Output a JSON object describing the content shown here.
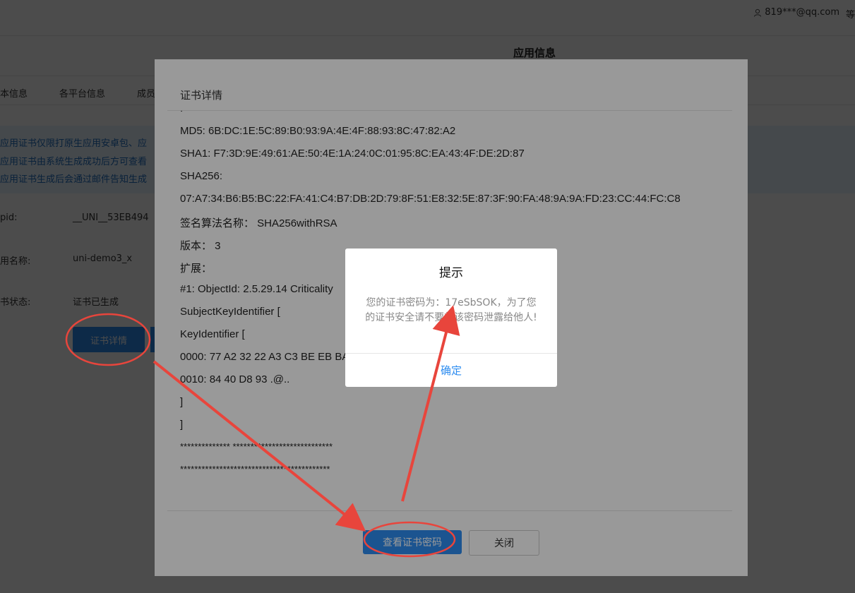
{
  "header": {
    "user_email": "819***@qq.com",
    "edge_char": "等"
  },
  "page": {
    "title": "应用信息"
  },
  "tabs": [
    "本信息",
    "各平台信息",
    "成员"
  ],
  "notice": [
    "应用证书仅限打原生应用安卓包、应",
    "应用证书由系统生成成功后方可查看",
    "应用证书生成后会通过邮件告知生成"
  ],
  "fields": [
    {
      "label": "pid:",
      "value": "__UNI__53EB494"
    },
    {
      "label": "用名称:",
      "value": "uni-demo3_x"
    },
    {
      "label": "书状态:",
      "value": "证书已生成"
    }
  ],
  "detail_button": "证书详情",
  "cert_dialog": {
    "title": "证书详情",
    "lines": [
      "MD5: 6B:DC:1E:5C:89:B0:93:9A:4E:4F:88:93:8C:47:82:A2",
      "SHA1: F7:3D:9E:49:61:AE:50:4E:1A:24:0C:01:95:8C:EA:43:4F:DE:2D:87",
      "SHA256:",
      "07:A7:34:B6:B5:BC:22:FA:41:C4:B7:DB:2D:79:8F:51:E8:32:5E:87:3F:90:FA:48:9A:9A:FD:23:CC:44:FC:C8",
      "签名算法名称： SHA256withRSA",
      "版本： 3",
      "扩展：",
      "#1: ObjectId: 2.5.29.14 Criticality",
      "SubjectKeyIdentifier [",
      "KeyIdentifier [",
      "0000: 77 A2 32 22 A3 C3 BE EB BA",
      "0010: 84 40 D8 93 .@..",
      "]",
      "]",
      "**************  ****************************",
      "******************************************"
    ],
    "view_password_button": "查看证书密码",
    "close_button": "关闭"
  },
  "alert": {
    "title": "提示",
    "message": "您的证书密码为：17eSbSOK，为了您的证书安全请不要将该密码泄露给他人!",
    "ok_button": "确定"
  },
  "colors": {
    "primary": "#2d8cf0",
    "annotation": "#e8453c"
  }
}
